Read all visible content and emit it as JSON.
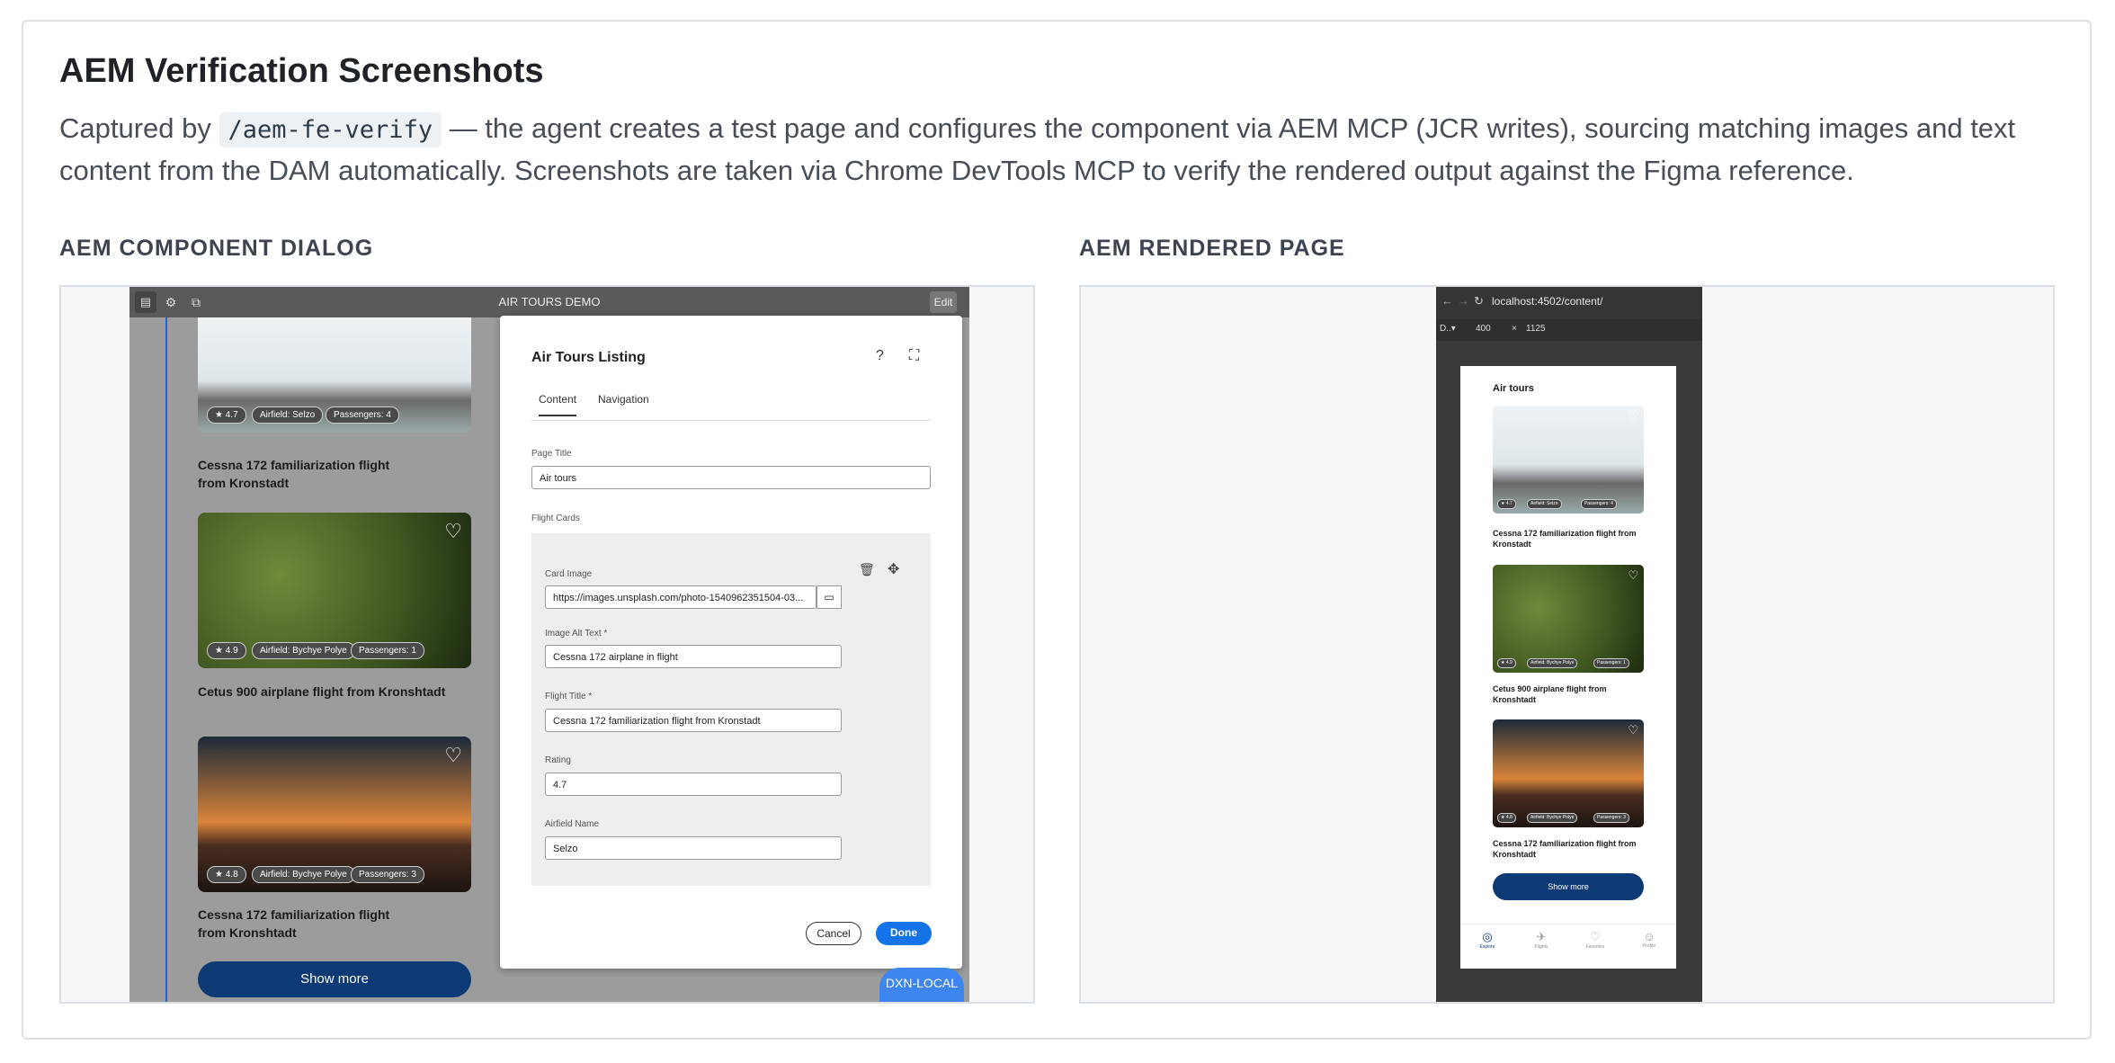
{
  "heading": "AEM Verification Screenshots",
  "description": {
    "prefix": "Captured by ",
    "code": "/aem-fe-verify",
    "suffix": " — the agent creates a test page and configures the component via AEM MCP (JCR writes), sourcing matching images and text content from the DAM automatically. Screenshots are taken via Chrome DevTools MCP to verify the rendered output against the Figma reference."
  },
  "left_panel": {
    "label": "AEM COMPONENT DIALOG",
    "app_title": "AIR TOURS DEMO",
    "edit_label": "Edit",
    "cards": [
      {
        "title": "Cessna 172 familiarization flight from Kronstadt",
        "rating": "★ 4.7",
        "airfield": "Airfield: Selzo",
        "passengers": "Passengers: 4"
      },
      {
        "title": "Cetus 900 airplane flight from Kronshtadt",
        "rating": "★ 4.9",
        "airfield": "Airfield: Bychye Polye",
        "passengers": "Passengers: 1"
      },
      {
        "title": "Cessna 172 familiarization flight from Kronshtadt",
        "rating": "★ 4.8",
        "airfield": "Airfield: Bychye Polye",
        "passengers": "Passengers: 3"
      }
    ],
    "show_more": "Show more",
    "dialog": {
      "title": "Air Tours Listing",
      "tabs": [
        "Content",
        "Navigation"
      ],
      "page_title_label": "Page Title",
      "page_title_value": "Air tours",
      "flight_cards_label": "Flight Cards",
      "card_image_label": "Card Image",
      "card_image_value": "https://images.unsplash.com/photo-1540962351504-03...",
      "alt_label": "Image Alt Text *",
      "alt_value": "Cessna 172 airplane in flight",
      "flight_title_label": "Flight Title *",
      "flight_title_value": "Cessna 172 familiarization flight from Kronstadt",
      "rating_label": "Rating",
      "rating_value": "4.7",
      "airfield_label": "Airfield Name",
      "airfield_value": "Selzo",
      "cancel": "Cancel",
      "done": "Done"
    },
    "env_badge": "DXN-LOCAL"
  },
  "right_panel": {
    "label": "AEM RENDERED PAGE",
    "url": "localhost:4502/content/",
    "device": "D..▾",
    "width": "400",
    "times": "×",
    "height": "1125",
    "page_title": "Air tours",
    "cards": [
      {
        "title": "Cessna 172 familiarization flight from Kronstadt",
        "rating": "★ 4.7",
        "airfield": "Airfield: Selzo",
        "passengers": "Passengers: 4"
      },
      {
        "title": "Cetus 900 airplane flight from Kronshtadt",
        "rating": "★ 4.9",
        "airfield": "Airfield: Bychye Polye",
        "passengers": "Passengers: 1"
      },
      {
        "title": "Cessna 172 familiarization flight from Kronshtadt",
        "rating": "★ 4.8",
        "airfield": "Airfield: Bychye Polye",
        "passengers": "Passengers: 3"
      }
    ],
    "show_more": "Show more",
    "nav": [
      "Explore",
      "Flights",
      "Favorites",
      "Profile"
    ]
  }
}
